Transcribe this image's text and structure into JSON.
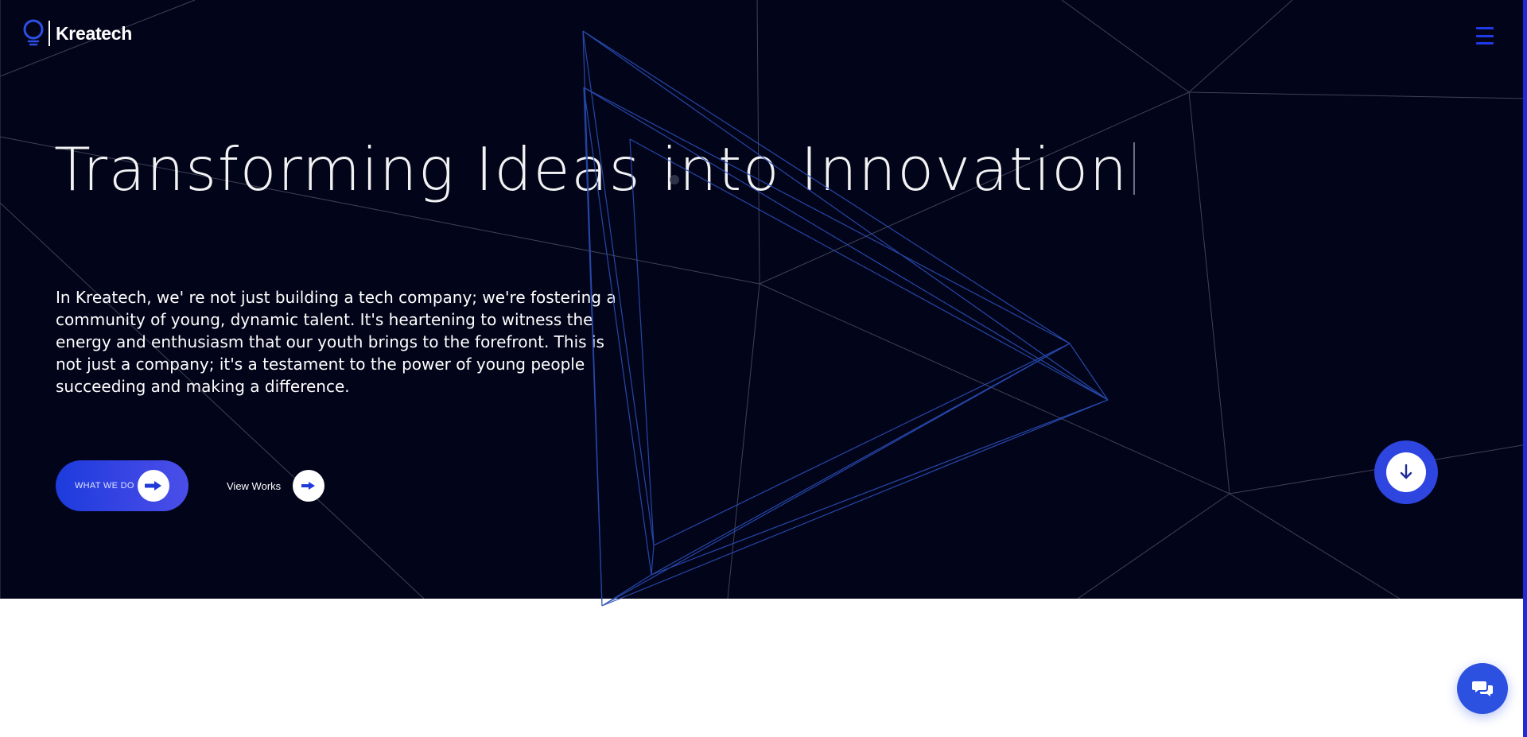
{
  "brand": {
    "name": "Kreatech",
    "logo_icon": "lightbulb-icon"
  },
  "header": {
    "menu_icon": "hamburger-menu-icon"
  },
  "hero": {
    "headline": "Transforming Ideas into Innovation",
    "intro": "In Kreatech, we' re not just building a tech company; we're fostering a community of young, dynamic talent. It's heartening to witness the energy and enthusiasm that our youth brings to the forefront. This is not just a company; it's a testament to the power of young people succeeding and making a difference.",
    "primary_cta": {
      "label": "WHAT WE DO",
      "icon": "arrow-right-icon"
    },
    "secondary_cta": {
      "label": "View Works",
      "icon": "arrow-right-icon"
    },
    "scroll_icon": "arrow-down-icon"
  },
  "chat": {
    "icon": "chat-bubbles-icon"
  },
  "colors": {
    "hero_background": "#020419",
    "accent": "#2e45e0",
    "edge_bar": "#1f2ad8",
    "background_lines": "#4a4e63",
    "triangle_lines": "#2a4fb8"
  }
}
